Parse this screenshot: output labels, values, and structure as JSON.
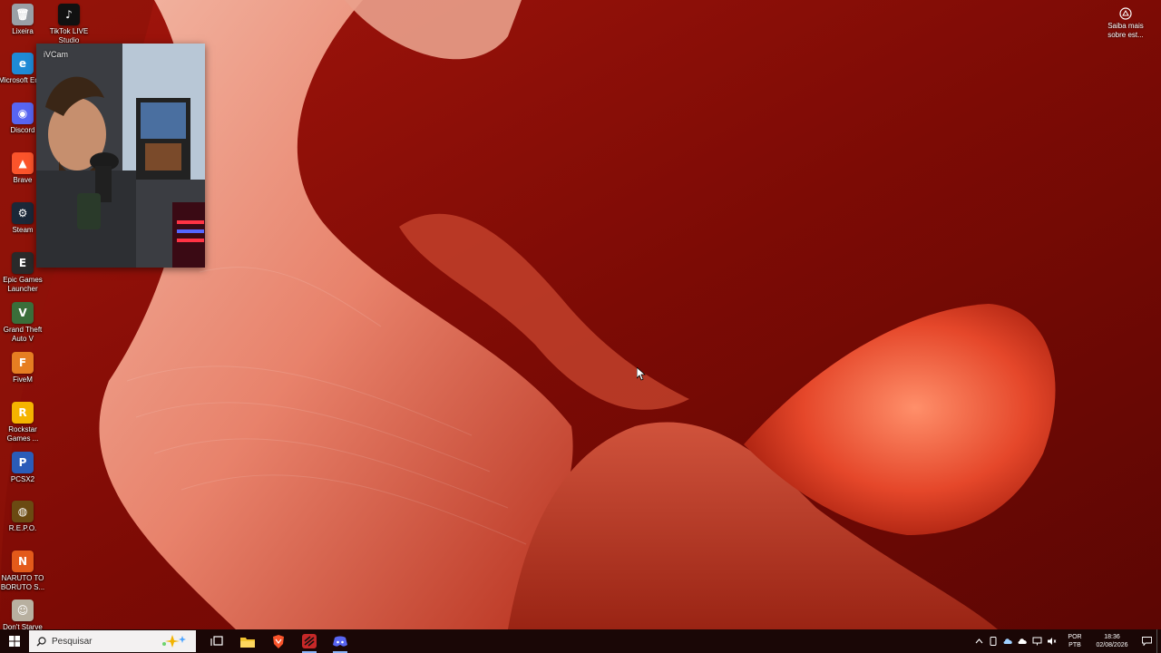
{
  "desktop": {
    "icons": [
      {
        "label": "Lixeira",
        "color": "#9aa0a6",
        "glyph": "🗑"
      },
      {
        "label": "TikTok LIVE Studio",
        "color": "#111111",
        "glyph": "♪"
      },
      {
        "label": "Microsoft Edge",
        "color": "#1f8ad6",
        "glyph": "e"
      },
      {
        "label": "Discord",
        "color": "#5865f2",
        "glyph": "◉"
      },
      {
        "label": "Brave",
        "color": "#fb542b",
        "glyph": "▲"
      },
      {
        "label": "Steam",
        "color": "#1b2838",
        "glyph": "⚙"
      },
      {
        "label": "Epic Games Launcher",
        "color": "#2a2a2a",
        "glyph": "E"
      },
      {
        "label": "Grand Theft Auto V",
        "color": "#3a6e3a",
        "glyph": "V"
      },
      {
        "label": "FiveM",
        "color": "#e67e22",
        "glyph": "F"
      },
      {
        "label": "Rockstar Games ...",
        "color": "#f5b400",
        "glyph": "R"
      },
      {
        "label": "PCSX2",
        "color": "#2b5cb8",
        "glyph": "P"
      },
      {
        "label": "R.E.P.O.",
        "color": "#6b4a12",
        "glyph": "◍"
      },
      {
        "label": "NARUTO TO BORUTO S...",
        "color": "#e35a1a",
        "glyph": "N"
      },
      {
        "label": "Don't Starve",
        "color": "#b8b0a0",
        "glyph": "☺"
      }
    ],
    "saiba_label": "Saiba mais sobre est..."
  },
  "ivcam": {
    "title": "iVCam"
  },
  "taskbar": {
    "search_placeholder": "Pesquisar",
    "lang_line1": "POR",
    "lang_line2": "PTB",
    "time": "18:36",
    "date": "02/08/2026",
    "accent": "#8ab4f8"
  }
}
